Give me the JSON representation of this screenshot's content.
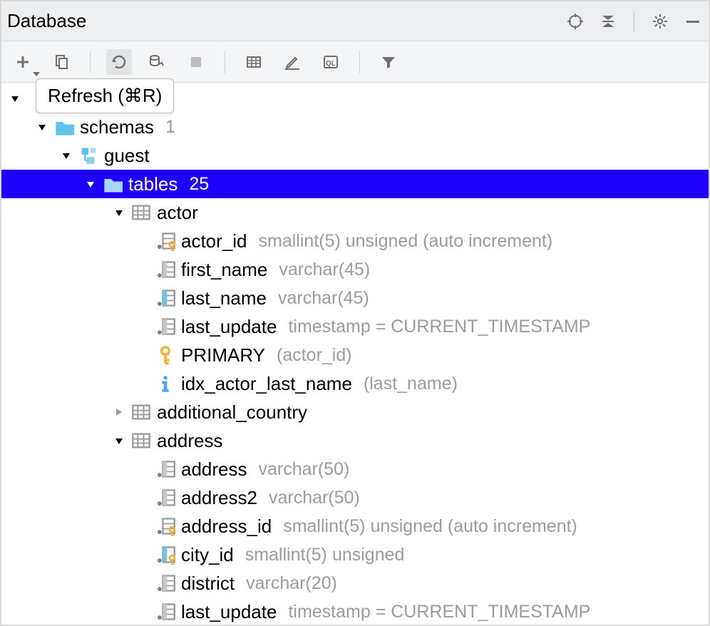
{
  "titlebar": {
    "title": "Database"
  },
  "tooltip": "Refresh (⌘R)",
  "tree": {
    "root_blank": "",
    "schemas": {
      "label": "schemas",
      "count": "1"
    },
    "guest": {
      "label": "guest"
    },
    "tables": {
      "label": "tables",
      "count": "25"
    },
    "actor": {
      "label": "actor",
      "cols": {
        "actor_id": {
          "name": "actor_id",
          "type": "smallint(5) unsigned (auto increment)"
        },
        "first_name": {
          "name": "first_name",
          "type": "varchar(45)"
        },
        "last_name": {
          "name": "last_name",
          "type": "varchar(45)"
        },
        "last_update": {
          "name": "last_update",
          "type": "timestamp = CURRENT_TIMESTAMP"
        }
      },
      "primary": {
        "name": "PRIMARY",
        "detail": "(actor_id)"
      },
      "index": {
        "name": "idx_actor_last_name",
        "detail": "(last_name)"
      }
    },
    "additional_country": {
      "label": "additional_country"
    },
    "address": {
      "label": "address",
      "cols": {
        "address": {
          "name": "address",
          "type": "varchar(50)"
        },
        "address2": {
          "name": "address2",
          "type": "varchar(50)"
        },
        "address_id": {
          "name": "address_id",
          "type": "smallint(5) unsigned (auto increment)"
        },
        "city_id": {
          "name": "city_id",
          "type": "smallint(5) unsigned"
        },
        "district": {
          "name": "district",
          "type": "varchar(20)"
        },
        "last_update": {
          "name": "last_update",
          "type": "timestamp = CURRENT_TIMESTAMP"
        }
      }
    }
  }
}
